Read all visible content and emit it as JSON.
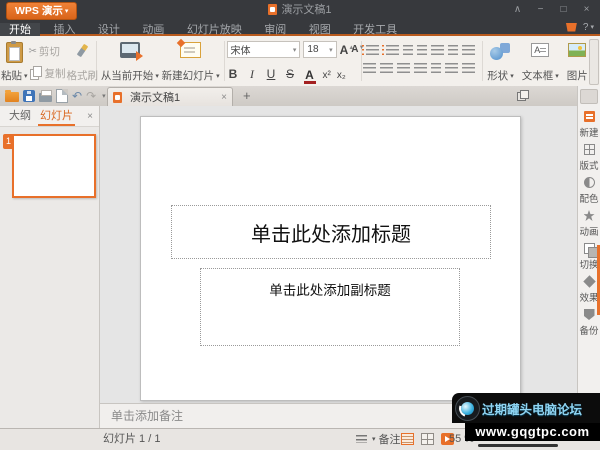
{
  "icons": {
    "caret_down": "▾",
    "scissors": "✂",
    "undo": "↶",
    "redo": "↷",
    "close": "×",
    "plus": "+",
    "help": "?",
    "grow_font": "A",
    "shrink_font": "A",
    "textbox_glyph": "A"
  },
  "titlebar": {
    "app_button": "WPS 演示",
    "document_title": "演示文稿1",
    "controls": {
      "rollup": "∧",
      "minimize": "−",
      "maximize": "□",
      "close": "×"
    }
  },
  "menu_tabs": {
    "items": [
      "开始",
      "插入",
      "设计",
      "动画",
      "幻灯片放映",
      "审阅",
      "视图",
      "开发工具"
    ]
  },
  "ribbon": {
    "paste": "粘贴",
    "cut": "剪切",
    "copy": "复制",
    "format_painter": "格式刷",
    "from_current": "从当前开始",
    "new_slide": "新建幻灯片",
    "font_name": "宋体",
    "font_size": "18",
    "bold": "B",
    "italic": "I",
    "underline": "U",
    "strike": "S",
    "font_color": "A",
    "superscript": "x²",
    "subscript": "x₂",
    "shapes": "形状",
    "textbox": "文本框",
    "picture": "图片"
  },
  "document_tab": {
    "label": "演示文稿1"
  },
  "left_panel": {
    "outline_tab": "大纲",
    "slides_tab": "幻灯片",
    "slide_number": "1"
  },
  "slide": {
    "title_placeholder": "单击此处添加标题",
    "subtitle_placeholder": "单击此处添加副标题"
  },
  "right_sidebar": {
    "items": [
      {
        "label": "新建"
      },
      {
        "label": "版式"
      },
      {
        "label": "配色"
      },
      {
        "label": "动画"
      },
      {
        "label": "切换"
      },
      {
        "label": "效果"
      },
      {
        "label": "备份"
      }
    ]
  },
  "notes": {
    "placeholder": "单击添加备注"
  },
  "status_bar": {
    "slide_indicator": "幻灯片 1 / 1",
    "notes_label": "备注",
    "zoom_level": "55 %"
  },
  "watermark": {
    "line1": "过期罐头电脑论坛",
    "line2": "www.gqgtpc.com"
  }
}
